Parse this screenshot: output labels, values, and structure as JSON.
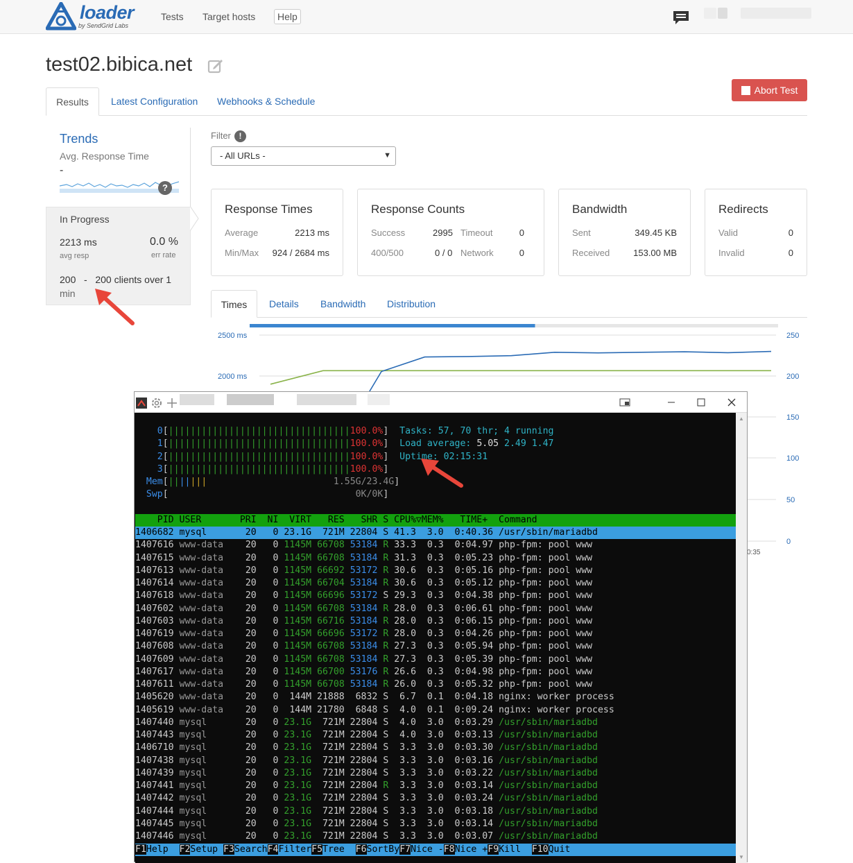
{
  "app": {
    "logo_text": "loader",
    "logo_sub": "by SendGrid Labs",
    "nav": [
      "Tests",
      "Target hosts",
      "Help"
    ]
  },
  "page": {
    "title": "test02.bibica.net",
    "abort_label": "Abort Test",
    "tabs": [
      "Results",
      "Latest Configuration",
      "Webhooks & Schedule"
    ]
  },
  "trends": {
    "title": "Trends",
    "subtitle": "Avg. Response Time",
    "value": "-",
    "help": "?",
    "status": "In Progress",
    "avg_resp_value": "2213 ms",
    "avg_resp_label": "avg resp",
    "err_rate_value": "0.0 %",
    "err_rate_label": "err rate",
    "clients_line1": "200   -   200 clients over 1",
    "clients_line2": "min"
  },
  "filter": {
    "label": "Filter",
    "info": "!",
    "selected": "- All URLs -"
  },
  "cards": {
    "response_times": {
      "title": "Response Times",
      "average_label": "Average",
      "average": "2213 ms",
      "minmax_label": "Min/Max",
      "minmax": "924 / 2684 ms"
    },
    "response_counts": {
      "title": "Response Counts",
      "success_label": "Success",
      "success": "2995",
      "timeout_label": "Timeout",
      "timeout": "0",
      "r400_label": "400/500",
      "r400": "0 / 0",
      "network_label": "Network",
      "network": "0"
    },
    "bandwidth": {
      "title": "Bandwidth",
      "sent_label": "Sent",
      "sent": "349.45 KB",
      "received_label": "Received",
      "received": "153.00 MB"
    },
    "redirects": {
      "title": "Redirects",
      "valid_label": "Valid",
      "valid": "0",
      "invalid_label": "Invalid",
      "invalid": "0"
    }
  },
  "subtabs": [
    "Times",
    "Details",
    "Bandwidth",
    "Distribution"
  ],
  "chart_data": {
    "type": "line",
    "y_left_ticks": [
      "2500 ms",
      "2000 ms"
    ],
    "y_right_ticks": [
      "250",
      "200",
      "150",
      "100",
      "50",
      "0"
    ],
    "x_tick_partial": "0:35",
    "progress_fraction": 0.54,
    "series": [
      {
        "values": [
          1900,
          2065,
          2065,
          2065,
          2065,
          2065,
          2065,
          2065,
          2065,
          2065,
          2065
        ]
      },
      {
        "values": [
          1800,
          2055,
          2232,
          2238,
          2248,
          2290,
          2282,
          2290,
          2296,
          2285,
          2300
        ]
      }
    ],
    "colors": {
      "green": "#8ab34a",
      "blue": "#2a6bb5"
    }
  },
  "terminal": {
    "cpu": [
      {
        "id": "0",
        "pct": "100.0%"
      },
      {
        "id": "1",
        "pct": "100.0%"
      },
      {
        "id": "2",
        "pct": "100.0%"
      },
      {
        "id": "3",
        "pct": "100.0%"
      }
    ],
    "mem_label": "Mem",
    "mem_value": "1.55G/23.4G",
    "swp_label": "Swp",
    "swp_value": "0K/0K",
    "tasks_line": "Tasks: 57, 70 thr; 4 running",
    "load_line": "Load average: 5.05 2.49 1.47",
    "uptime_line": "Uptime: 02:15:31",
    "header": "    PID USER       PRI  NI  VIRT   RES   SHR S CPU%▽MEM%   TIME+  Command",
    "processes": [
      [
        "1406682",
        "mysql",
        "20",
        "0",
        "23.1G",
        "721M",
        "22804",
        "S",
        "41.3",
        "3.0",
        "0:40.36",
        "/usr/sbin/mariadbd"
      ],
      [
        "1407616",
        "www-data",
        "20",
        "0",
        "1145M",
        "66708",
        "53184",
        "R",
        "33.3",
        "0.3",
        "0:04.97",
        "php-fpm: pool www"
      ],
      [
        "1407615",
        "www-data",
        "20",
        "0",
        "1145M",
        "66708",
        "53184",
        "R",
        "31.3",
        "0.3",
        "0:05.23",
        "php-fpm: pool www"
      ],
      [
        "1407613",
        "www-data",
        "20",
        "0",
        "1145M",
        "66692",
        "53172",
        "R",
        "30.6",
        "0.3",
        "0:05.16",
        "php-fpm: pool www"
      ],
      [
        "1407614",
        "www-data",
        "20",
        "0",
        "1145M",
        "66704",
        "53184",
        "R",
        "30.6",
        "0.3",
        "0:05.12",
        "php-fpm: pool www"
      ],
      [
        "1407618",
        "www-data",
        "20",
        "0",
        "1145M",
        "66696",
        "53172",
        "S",
        "29.3",
        "0.3",
        "0:04.38",
        "php-fpm: pool www"
      ],
      [
        "1407602",
        "www-data",
        "20",
        "0",
        "1145M",
        "66708",
        "53184",
        "R",
        "28.0",
        "0.3",
        "0:06.61",
        "php-fpm: pool www"
      ],
      [
        "1407603",
        "www-data",
        "20",
        "0",
        "1145M",
        "66716",
        "53184",
        "R",
        "28.0",
        "0.3",
        "0:06.15",
        "php-fpm: pool www"
      ],
      [
        "1407619",
        "www-data",
        "20",
        "0",
        "1145M",
        "66696",
        "53172",
        "R",
        "28.0",
        "0.3",
        "0:04.26",
        "php-fpm: pool www"
      ],
      [
        "1407608",
        "www-data",
        "20",
        "0",
        "1145M",
        "66708",
        "53184",
        "R",
        "27.3",
        "0.3",
        "0:05.94",
        "php-fpm: pool www"
      ],
      [
        "1407609",
        "www-data",
        "20",
        "0",
        "1145M",
        "66708",
        "53184",
        "R",
        "27.3",
        "0.3",
        "0:05.39",
        "php-fpm: pool www"
      ],
      [
        "1407617",
        "www-data",
        "20",
        "0",
        "1145M",
        "66700",
        "53176",
        "R",
        "26.6",
        "0.3",
        "0:04.98",
        "php-fpm: pool www"
      ],
      [
        "1407611",
        "www-data",
        "20",
        "0",
        "1145M",
        "66708",
        "53184",
        "R",
        "26.0",
        "0.3",
        "0:05.32",
        "php-fpm: pool www"
      ],
      [
        "1405620",
        "www-data",
        "20",
        "0",
        "144M",
        "21888",
        "6832",
        "S",
        "6.7",
        "0.1",
        "0:04.18",
        "nginx: worker process"
      ],
      [
        "1405619",
        "www-data",
        "20",
        "0",
        "144M",
        "21780",
        "6848",
        "S",
        "4.0",
        "0.1",
        "0:09.24",
        "nginx: worker process"
      ],
      [
        "1407440",
        "mysql",
        "20",
        "0",
        "23.1G",
        "721M",
        "22804",
        "S",
        "4.0",
        "3.0",
        "0:03.29",
        "/usr/sbin/mariadbd"
      ],
      [
        "1407443",
        "mysql",
        "20",
        "0",
        "23.1G",
        "721M",
        "22804",
        "S",
        "4.0",
        "3.0",
        "0:03.13",
        "/usr/sbin/mariadbd"
      ],
      [
        "1406710",
        "mysql",
        "20",
        "0",
        "23.1G",
        "721M",
        "22804",
        "S",
        "3.3",
        "3.0",
        "0:03.30",
        "/usr/sbin/mariadbd"
      ],
      [
        "1407438",
        "mysql",
        "20",
        "0",
        "23.1G",
        "721M",
        "22804",
        "S",
        "3.3",
        "3.0",
        "0:03.16",
        "/usr/sbin/mariadbd"
      ],
      [
        "1407439",
        "mysql",
        "20",
        "0",
        "23.1G",
        "721M",
        "22804",
        "S",
        "3.3",
        "3.0",
        "0:03.22",
        "/usr/sbin/mariadbd"
      ],
      [
        "1407441",
        "mysql",
        "20",
        "0",
        "23.1G",
        "721M",
        "22804",
        "R",
        "3.3",
        "3.0",
        "0:03.14",
        "/usr/sbin/mariadbd"
      ],
      [
        "1407442",
        "mysql",
        "20",
        "0",
        "23.1G",
        "721M",
        "22804",
        "S",
        "3.3",
        "3.0",
        "0:03.24",
        "/usr/sbin/mariadbd"
      ],
      [
        "1407444",
        "mysql",
        "20",
        "0",
        "23.1G",
        "721M",
        "22804",
        "S",
        "3.3",
        "3.0",
        "0:03.18",
        "/usr/sbin/mariadbd"
      ],
      [
        "1407445",
        "mysql",
        "20",
        "0",
        "23.1G",
        "721M",
        "22804",
        "S",
        "3.3",
        "3.0",
        "0:03.14",
        "/usr/sbin/mariadbd"
      ],
      [
        "1407446",
        "mysql",
        "20",
        "0",
        "23.1G",
        "721M",
        "22804",
        "S",
        "3.3",
        "3.0",
        "0:03.07",
        "/usr/sbin/mariadbd"
      ]
    ],
    "fkeys": [
      [
        "F1",
        "Help  "
      ],
      [
        "F2",
        "Setup "
      ],
      [
        "F3",
        "Search"
      ],
      [
        "F4",
        "Filter"
      ],
      [
        "F5",
        "Tree  "
      ],
      [
        "F6",
        "SortBy"
      ],
      [
        "F7",
        "Nice -"
      ],
      [
        "F8",
        "Nice +"
      ],
      [
        "F9",
        "Kill  "
      ],
      [
        "F10",
        "Quit"
      ]
    ]
  }
}
